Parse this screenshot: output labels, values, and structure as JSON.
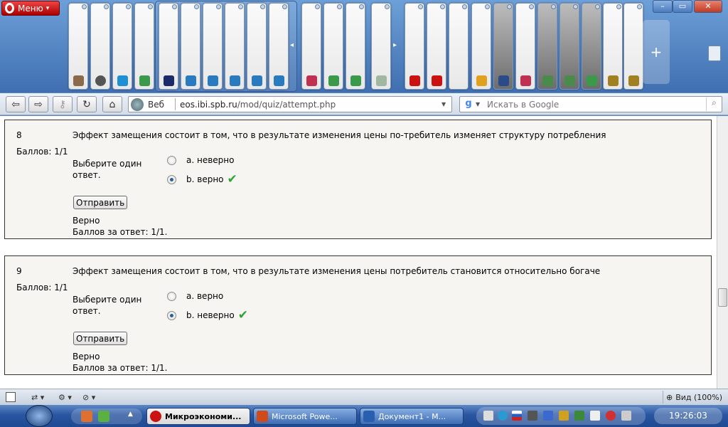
{
  "browser": {
    "menu_label": "Меню",
    "address": {
      "web_label": "Веб",
      "url_host": "eos.ibi.spb.ru",
      "url_path": "/mod/quiz/attempt.php"
    },
    "search": {
      "placeholder": "Искать в Google"
    },
    "zoom_label": "Вид (100%)"
  },
  "quiz": {
    "questions": [
      {
        "number": "8",
        "score": "Баллов: 1/1",
        "text": "Эффект замещения состоит в том, что в результате изменения цены по-требитель изменяет структуру потребления",
        "prompt": "Выберите один ответ.",
        "answers": [
          {
            "label": "a. неверно",
            "selected": false
          },
          {
            "label": "b. верно",
            "selected": true
          }
        ],
        "submit_label": "Отправить",
        "result": "Верно",
        "result_score": "Баллов за ответ: 1/1."
      },
      {
        "number": "9",
        "score": "Баллов: 1/1",
        "text": "Эффект замещения состоит в том, что в результате изменения цены потребитель становится относительно богаче",
        "prompt": "Выберите один ответ.",
        "answers": [
          {
            "label": "a. верно",
            "selected": false
          },
          {
            "label": "b. неверно",
            "selected": true
          }
        ],
        "submit_label": "Отправить",
        "result": "Верно",
        "result_score": "Баллов за ответ: 1/1."
      }
    ]
  },
  "taskbar": {
    "buttons": [
      {
        "label": "Микроэкономи...",
        "active": true
      },
      {
        "label": "Microsoft Powe...",
        "active": false
      },
      {
        "label": "Документ1 - M...",
        "active": false
      }
    ],
    "clock": "19:26:03"
  },
  "colors": {
    "accent": "#2b5f9a",
    "check": "#2ea32e",
    "opera_red": "#cc1111"
  }
}
